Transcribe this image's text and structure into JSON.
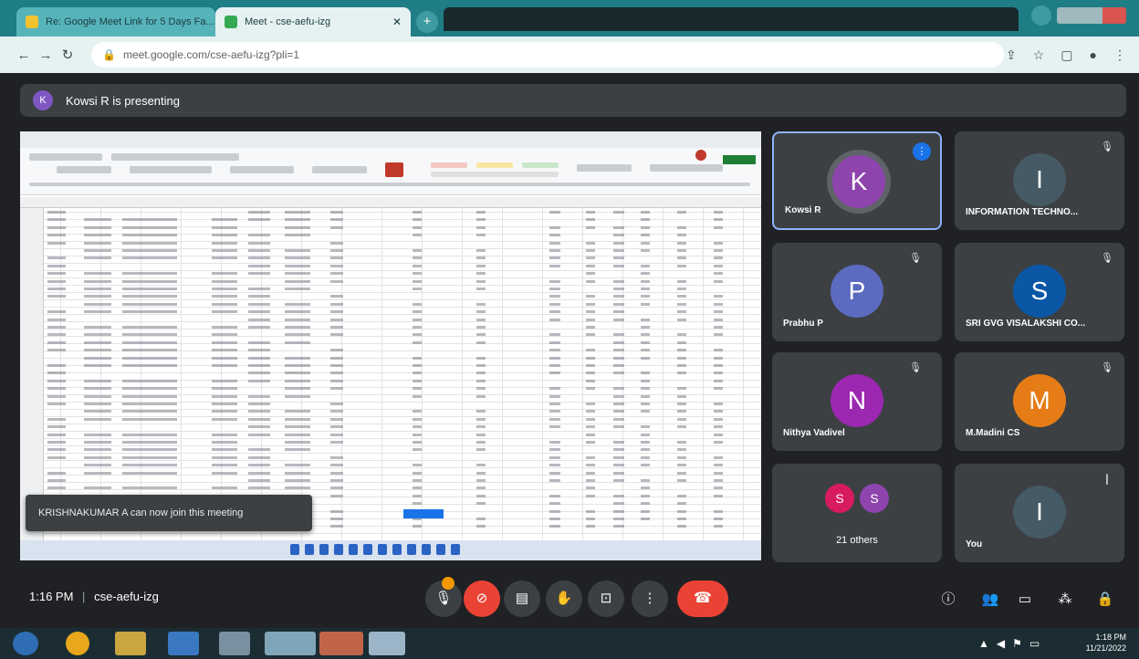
{
  "browser": {
    "tabs": [
      {
        "title": "Re: Google Meet Link for 5 Days Fa..."
      },
      {
        "title": "Meet - cse-aefu-izg"
      }
    ],
    "new_tab_label": "+",
    "url": "meet.google.com/cse-aefu-izg?pli=1"
  },
  "meet": {
    "presenting_avatar": "K",
    "presenting_text": "Kowsi R is presenting",
    "toast": "KRISHNAKUMAR A can now join this meeting",
    "time": "1:16 PM",
    "separator": "|",
    "meeting_code": "cse-aefu-izg",
    "participants": [
      {
        "initial": "K",
        "name": "Kowsi R",
        "color": "#8e44ad",
        "speaking": true
      },
      {
        "initial": "I",
        "name": "INFORMATION TECHNO...",
        "color": "#455a64",
        "speaking": false
      },
      {
        "initial": "P",
        "name": "Prabhu P",
        "color": "#5c6bc0",
        "speaking": false
      },
      {
        "initial": "S",
        "name": "SRI GVG VISALAKSHI CO...",
        "color": "#0b57a6",
        "speaking": false
      },
      {
        "initial": "N",
        "name": "Nithya Vadivel",
        "color": "#9c27b0",
        "speaking": false
      },
      {
        "initial": "M",
        "name": "M.Madini CS",
        "color": "#e67c16",
        "speaking": false
      },
      {
        "initial": "I",
        "name": "You",
        "color": "#455a64",
        "speaking": false
      }
    ],
    "others": {
      "initials": [
        "S",
        "S"
      ],
      "colors": [
        "#d81b60",
        "#8e44ad"
      ],
      "label": "21 others"
    }
  },
  "taskbar": {
    "clock_time": "1:18 PM",
    "clock_date": "11/21/2022"
  },
  "colors": {
    "accent": "#1f7d86",
    "end_call": "#ea4335",
    "tile_bg": "#3c4043"
  }
}
